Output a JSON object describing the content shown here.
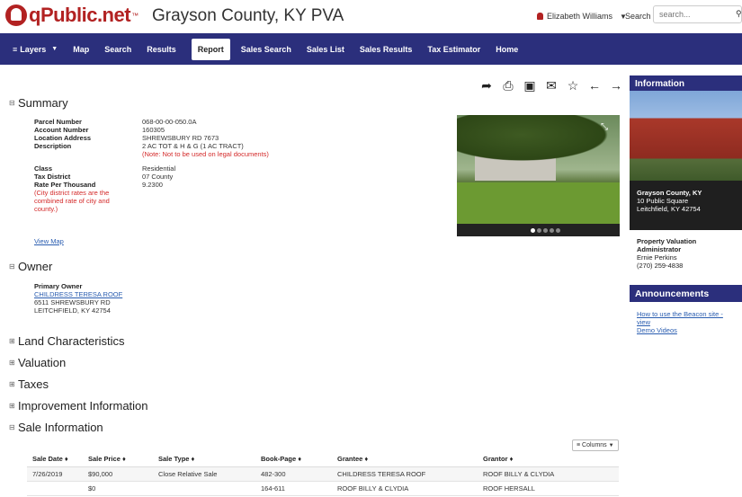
{
  "header": {
    "logo_text": "qPublic.net",
    "logo_tm": "™",
    "title": "Grayson County, KY PVA",
    "user_name": "Elizabeth Williams",
    "search_label": "Search",
    "search_placeholder": "search..."
  },
  "nav": {
    "items": [
      "Layers",
      "Map",
      "Search",
      "Results",
      "Report",
      "Sales Search",
      "Sales List",
      "Sales Results",
      "Tax Estimator",
      "Home"
    ],
    "active": "Report"
  },
  "summary": {
    "heading": "Summary",
    "parcel_label": "Parcel Number",
    "parcel_value": "068-00-00-050.0A",
    "account_label": "Account Number",
    "account_value": "160305",
    "location_label": "Location Address",
    "location_value": "SHREWSBURY RD 7673",
    "desc_label": "Description",
    "desc_value": "2 AC TOT & H & G (1 AC TRACT)",
    "desc_note": "(Note: Not to be used on legal documents)",
    "class_label": "Class",
    "class_value": "Residential",
    "district_label": "Tax District",
    "district_value": "07 County",
    "rate_label": "Rate Per Thousand",
    "rate_value": "9.2300",
    "rate_note_1": "(City district rates are the",
    "rate_note_2": "combined rate of city and",
    "rate_note_3": "county.)",
    "view_map": "View Map"
  },
  "owner": {
    "heading": "Owner",
    "primary_label": "Primary Owner",
    "name": "CHILDRESS TERESA ROOF",
    "addr1": "6511 SHREWSBURY RD",
    "addr2": "LEITCHFIELD, KY 42754"
  },
  "sections": {
    "land": "Land Characteristics",
    "valuation": "Valuation",
    "taxes": "Taxes",
    "improvement": "Improvement Information",
    "sale": "Sale Information"
  },
  "sidebar": {
    "info_heading": "Information",
    "county": "Grayson County, KY",
    "street": "10 Public Square",
    "city": "Leitchfield, KY 42754",
    "pva_title_1": "Property Valuation",
    "pva_title_2": "Administrator",
    "pva_name": "Ernie Perkins",
    "pva_phone": "(270) 259-4838",
    "announcements_heading": "Announcements",
    "announce_link_1": "How to use the Beacon site - view",
    "announce_link_2": "Demo Videos"
  },
  "sale_table": {
    "columns_button": "Columns",
    "headers": [
      "Sale Date ♦",
      "Sale Price ♦",
      "Sale Type ♦",
      "Book-Page ♦",
      "Grantee ♦",
      "Grantor ♦"
    ],
    "rows": [
      [
        "7/26/2019",
        "$90,000",
        "Close Relative Sale",
        "482-300",
        "CHILDRESS TERESA ROOF",
        "ROOF BILLY & CLYDIA"
      ],
      [
        "",
        "$0",
        "",
        "164-611",
        "ROOF BILLY & CLYDIA",
        "ROOF HERSALL"
      ]
    ]
  },
  "colors": {
    "nav": "#2b2f7c",
    "brand_red": "#b22222",
    "note_red": "#d42a2a",
    "link": "#2a5db0"
  }
}
